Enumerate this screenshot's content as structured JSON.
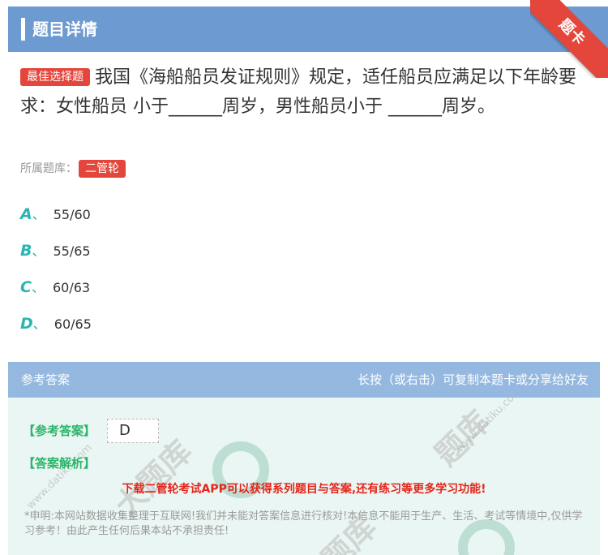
{
  "header": {
    "title": "题目详情"
  },
  "ribbon": {
    "label": "题卡"
  },
  "question": {
    "type_tag": "最佳选择题",
    "text": "我国《海船船员发证规则》规定，适任船员应满足以下年龄要求：女性船员 小于______周岁，男性船员小于 ______周岁。"
  },
  "bank": {
    "label": "所属题库：",
    "name": "二管轮"
  },
  "options": [
    {
      "letter": "A",
      "sep": "、",
      "text": "55/60"
    },
    {
      "letter": "B",
      "sep": "、",
      "text": "55/65"
    },
    {
      "letter": "C",
      "sep": "、",
      "text": "60/63"
    },
    {
      "letter": "D",
      "sep": "、",
      "text": "60/65"
    }
  ],
  "answer_section": {
    "title": "参考答案",
    "hint": "长按（或右击）可复制本题卡或分享给好友",
    "ref_label": "【参考答案】",
    "ref_value": "D",
    "analysis_label": "【答案解析】",
    "promo": "下载二管轮考试APP可以获得系列题目与答案,还有练习等更多学习功能!",
    "disclaimer": "*申明:本网站数据收集整理于互联网!我们并未能对答案信息进行核对!本信息不能用于生产、生活、考试等情境中,仅供学习参考！由此产生任何后果本站不承担责任!"
  },
  "colors": {
    "header": "#6d9ad0",
    "accent_red": "#e4463b",
    "option_letter": "#2bb5b0",
    "answer_label": "#2bb56a"
  }
}
